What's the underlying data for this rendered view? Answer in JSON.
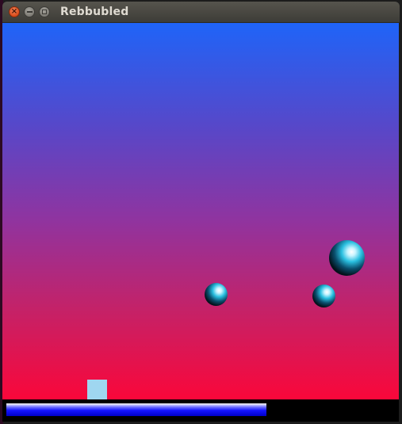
{
  "window": {
    "title": "Rebbubled"
  },
  "colors": {
    "sky_top": "#1f64f8",
    "sky_bottom": "#fa073a",
    "player": "#9fd6f0",
    "hud_background": "#000000",
    "timer_bar": "#1414ff"
  },
  "game": {
    "bubbles": [
      {
        "name": "bubble-small-left",
        "size": "small"
      },
      {
        "name": "bubble-small-right",
        "size": "small"
      },
      {
        "name": "bubble-medium",
        "size": "medium"
      }
    ]
  },
  "hud": {
    "timer_fraction": 0.67
  }
}
